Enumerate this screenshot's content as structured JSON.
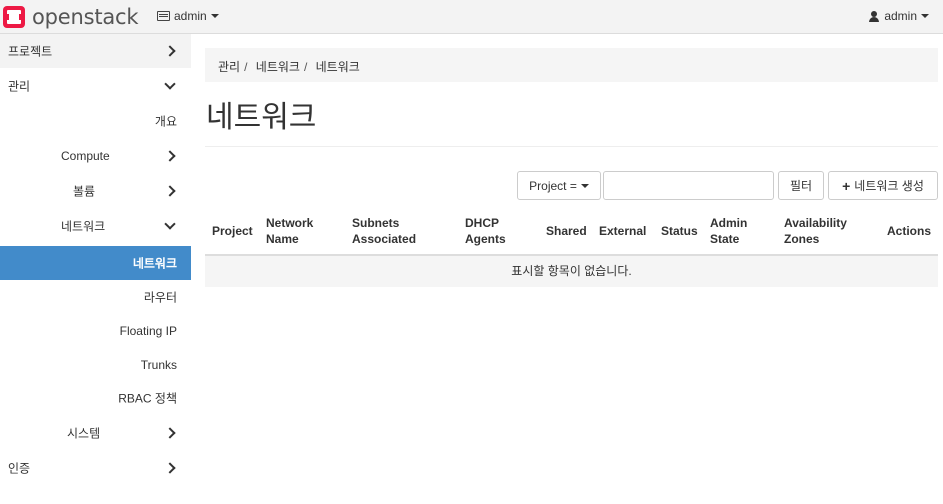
{
  "header": {
    "brand": "openstack",
    "project_dropdown": "admin",
    "user_dropdown": "admin"
  },
  "sidebar": {
    "items": [
      {
        "label": "프로젝트"
      },
      {
        "label": "관리"
      },
      {
        "label": "개요"
      },
      {
        "label": "Compute"
      },
      {
        "label": "볼륨"
      },
      {
        "label": "네트워크"
      },
      {
        "label": "네트워크"
      },
      {
        "label": "라우터"
      },
      {
        "label": "Floating IP"
      },
      {
        "label": "Trunks"
      },
      {
        "label": "RBAC 정책"
      },
      {
        "label": "시스템"
      },
      {
        "label": "인증"
      }
    ]
  },
  "breadcrumb": [
    "관리",
    "네트워크",
    "네트워크"
  ],
  "page_title": "네트워크",
  "toolbar": {
    "filter_select": "Project =",
    "search_value": "",
    "filter_button": "필터",
    "create_button": "네트워크 생성"
  },
  "table": {
    "columns": [
      [
        "Project",
        ""
      ],
      [
        "Network",
        "Name"
      ],
      [
        "Subnets",
        "Associated"
      ],
      [
        "DHCP",
        "Agents"
      ],
      [
        "Shared",
        ""
      ],
      [
        "External",
        ""
      ],
      [
        "Status",
        ""
      ],
      [
        "Admin",
        "State"
      ],
      [
        "Availability",
        "Zones"
      ],
      [
        "Actions",
        ""
      ]
    ],
    "empty_message": "표시할 항목이 없습니다."
  }
}
